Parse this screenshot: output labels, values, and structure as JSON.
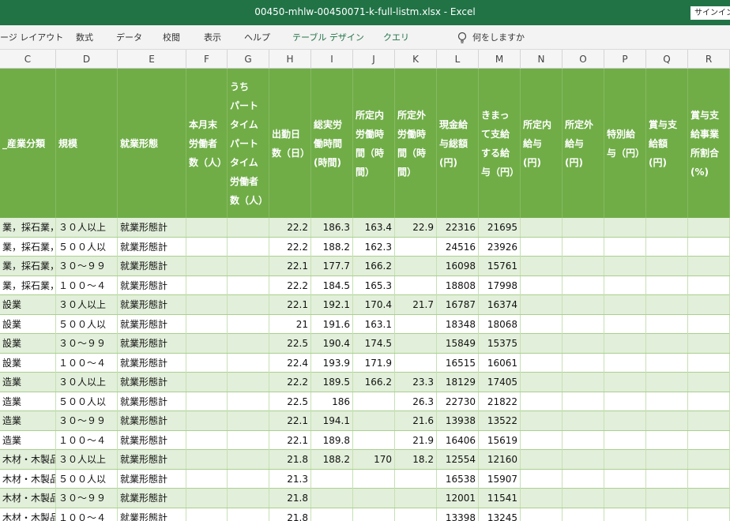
{
  "window": {
    "title": "00450-mhlw-00450071-k-full-listm.xlsx  -  Excel",
    "signin_label": "サインイン"
  },
  "ribbon": {
    "tabs": [
      "ージ レイアウト",
      "数式",
      "データ",
      "校閲",
      "表示",
      "ヘルプ"
    ],
    "context_tabs": [
      "テーブル デザイン",
      "クエリ"
    ],
    "tell_me": "何をしますか"
  },
  "columns": [
    "C",
    "D",
    "E",
    "F",
    "G",
    "H",
    "I",
    "J",
    "K",
    "L",
    "M",
    "N",
    "O",
    "P",
    "Q",
    "R"
  ],
  "table": {
    "headers": [
      "_産業分類",
      "規模",
      "就業形態",
      "本月末\n労働者\n数（人）",
      "うち\nパート\nタイム\nパート\nタイム\n労働者\n数（人）",
      "出勤日\n数（日）",
      "総実労\n働時間\n(時間)",
      "所定内\n労働時\n間（時\n間）",
      "所定外\n労働時\n間（時\n間）",
      "現金給\n与総額\n(円)",
      "きまっ\nて支給\nする給\n与（円）",
      "所定内\n給与\n(円)",
      "所定外\n給与\n(円)",
      "特別給\n与（円）",
      "賞与支\n給額\n(円)",
      "賞与支\n給事業\n所割合\n(%)"
    ],
    "rows": [
      [
        "業，採石業，",
        "３０人以上",
        "就業形態計",
        "",
        "",
        "22.2",
        "186.3",
        "163.4",
        "22.9",
        "22316",
        "21695",
        "",
        "",
        "",
        "",
        ""
      ],
      [
        "業，採石業，",
        "５００人以",
        "就業形態計",
        "",
        "",
        "22.2",
        "188.2",
        "162.3",
        "",
        "24516",
        "23926",
        "",
        "",
        "",
        "",
        ""
      ],
      [
        "業，採石業，",
        "３０～９９",
        "就業形態計",
        "",
        "",
        "22.1",
        "177.7",
        "166.2",
        "",
        "16098",
        "15761",
        "",
        "",
        "",
        "",
        ""
      ],
      [
        "業，採石業，",
        "１００～４",
        "就業形態計",
        "",
        "",
        "22.2",
        "184.5",
        "165.3",
        "",
        "18808",
        "17998",
        "",
        "",
        "",
        "",
        ""
      ],
      [
        "設業",
        "３０人以上",
        "就業形態計",
        "",
        "",
        "22.1",
        "192.1",
        "170.4",
        "21.7",
        "16787",
        "16374",
        "",
        "",
        "",
        "",
        ""
      ],
      [
        "設業",
        "５００人以",
        "就業形態計",
        "",
        "",
        "21",
        "191.6",
        "163.1",
        "",
        "18348",
        "18068",
        "",
        "",
        "",
        "",
        ""
      ],
      [
        "設業",
        "３０～９９",
        "就業形態計",
        "",
        "",
        "22.5",
        "190.4",
        "174.5",
        "",
        "15849",
        "15375",
        "",
        "",
        "",
        "",
        ""
      ],
      [
        "設業",
        "１００～４",
        "就業形態計",
        "",
        "",
        "22.4",
        "193.9",
        "171.9",
        "",
        "16515",
        "16061",
        "",
        "",
        "",
        "",
        ""
      ],
      [
        "造業",
        "３０人以上",
        "就業形態計",
        "",
        "",
        "22.2",
        "189.5",
        "166.2",
        "23.3",
        "18129",
        "17405",
        "",
        "",
        "",
        "",
        ""
      ],
      [
        "造業",
        "５００人以",
        "就業形態計",
        "",
        "",
        "22.5",
        "186",
        "",
        "26.3",
        "22730",
        "21822",
        "",
        "",
        "",
        "",
        ""
      ],
      [
        "造業",
        "３０～９９",
        "就業形態計",
        "",
        "",
        "22.1",
        "194.1",
        "",
        "21.6",
        "13938",
        "13522",
        "",
        "",
        "",
        "",
        ""
      ],
      [
        "造業",
        "１００～４",
        "就業形態計",
        "",
        "",
        "22.1",
        "189.8",
        "",
        "21.9",
        "16406",
        "15619",
        "",
        "",
        "",
        "",
        ""
      ],
      [
        "木材・木製品",
        "３０人以上",
        "就業形態計",
        "",
        "",
        "21.8",
        "188.2",
        "170",
        "18.2",
        "12554",
        "12160",
        "",
        "",
        "",
        "",
        ""
      ],
      [
        "木材・木製品",
        "５００人以",
        "就業形態計",
        "",
        "",
        "21.3",
        "",
        "",
        "",
        "16538",
        "15907",
        "",
        "",
        "",
        "",
        ""
      ],
      [
        "木材・木製品",
        "３０～９９",
        "就業形態計",
        "",
        "",
        "21.8",
        "",
        "",
        "",
        "12001",
        "11541",
        "",
        "",
        "",
        "",
        ""
      ],
      [
        "木材・木製品",
        "１００～４",
        "就業形態計",
        "",
        "",
        "21.8",
        "",
        "",
        "",
        "13398",
        "13245",
        "",
        "",
        "",
        "",
        ""
      ]
    ]
  }
}
